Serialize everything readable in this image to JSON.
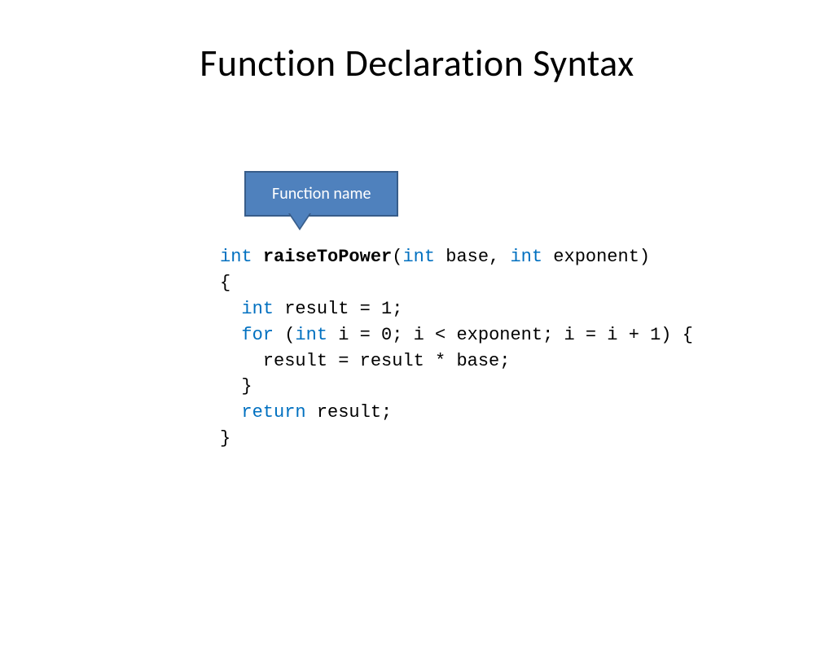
{
  "title": "Function Declaration Syntax",
  "callout": {
    "label": "Function name"
  },
  "code": {
    "tokens": [
      [
        {
          "t": "int ",
          "c": "kw"
        },
        {
          "t": "raiseToPower",
          "c": "fn"
        },
        {
          "t": "(",
          "c": ""
        },
        {
          "t": "int",
          "c": "kw"
        },
        {
          "t": " base, ",
          "c": ""
        },
        {
          "t": "int",
          "c": "kw"
        },
        {
          "t": " exponent)",
          "c": ""
        }
      ],
      [
        {
          "t": "{",
          "c": ""
        }
      ],
      [
        {
          "t": "  ",
          "c": ""
        },
        {
          "t": "int",
          "c": "kw"
        },
        {
          "t": " result = 1;",
          "c": ""
        }
      ],
      [
        {
          "t": "  ",
          "c": ""
        },
        {
          "t": "for",
          "c": "kw"
        },
        {
          "t": " (",
          "c": ""
        },
        {
          "t": "int",
          "c": "kw"
        },
        {
          "t": " i = 0; i < exponent; i = i + 1) {",
          "c": ""
        }
      ],
      [
        {
          "t": "    result = result * base;",
          "c": ""
        }
      ],
      [
        {
          "t": "  }",
          "c": ""
        }
      ],
      [
        {
          "t": "  ",
          "c": ""
        },
        {
          "t": "return",
          "c": "kw"
        },
        {
          "t": " result;",
          "c": ""
        }
      ],
      [
        {
          "t": "}",
          "c": ""
        }
      ]
    ]
  }
}
